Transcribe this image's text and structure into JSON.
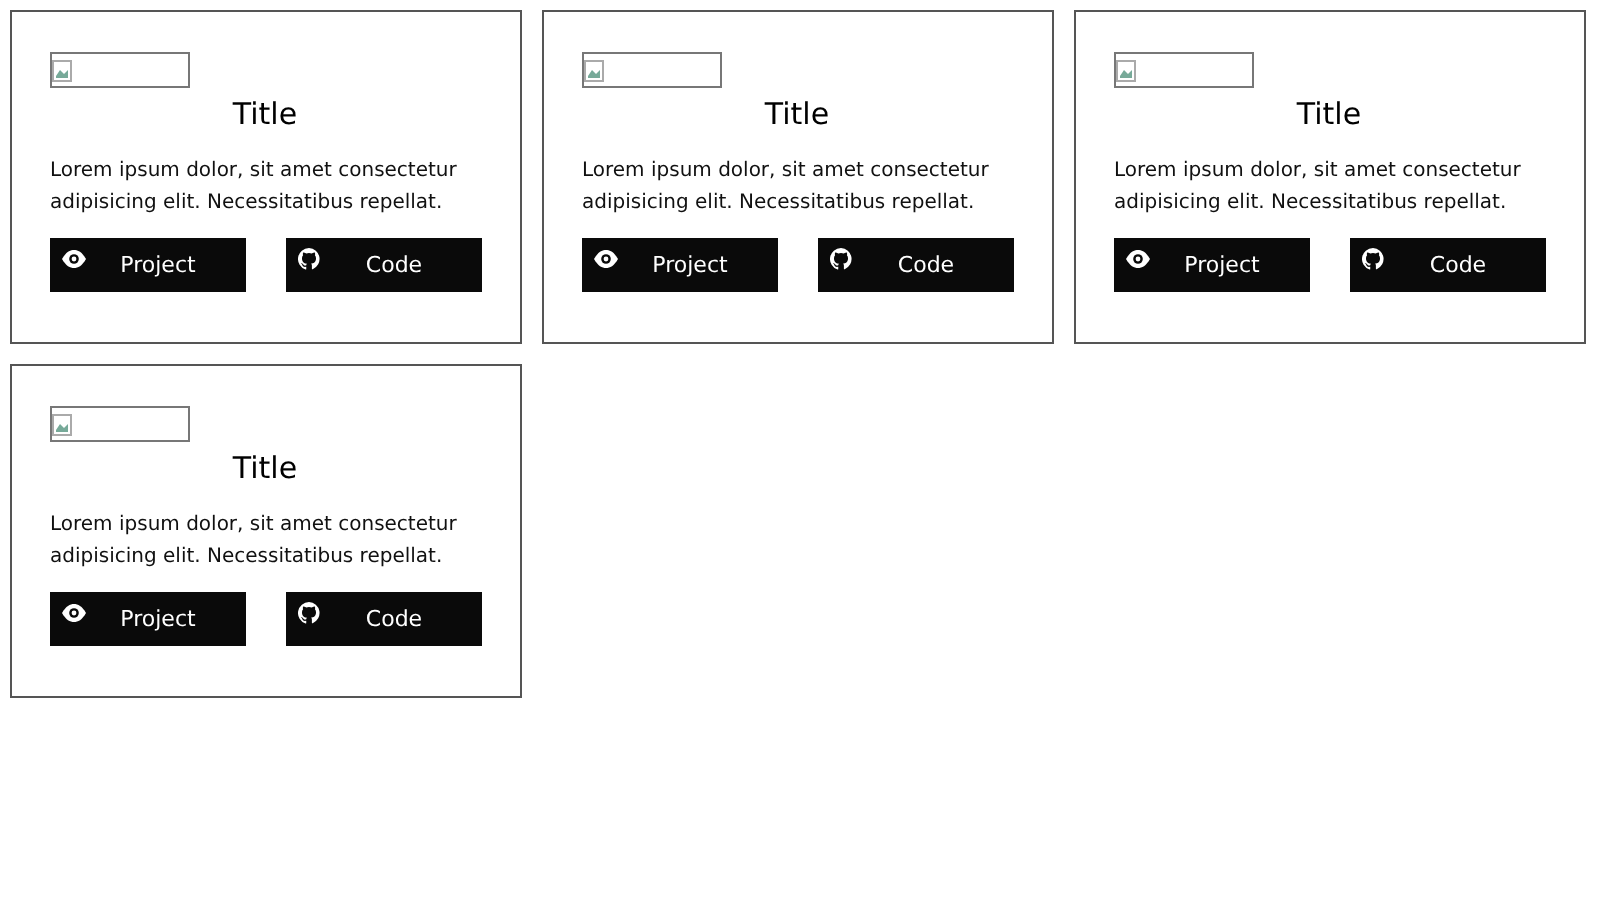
{
  "cards": [
    {
      "title": "Title",
      "description": "Lorem ipsum dolor, sit amet consectetur adipisicing elit. Necessitatibus repellat.",
      "buttons": [
        {
          "kind": "view",
          "label": "Project"
        },
        {
          "kind": "code",
          "label": "Code"
        }
      ]
    },
    {
      "title": "Title",
      "description": "Lorem ipsum dolor, sit amet consectetur adipisicing elit. Necessitatibus repellat.",
      "buttons": [
        {
          "kind": "view",
          "label": "Project"
        },
        {
          "kind": "code",
          "label": "Code"
        }
      ]
    },
    {
      "title": "Title",
      "description": "Lorem ipsum dolor, sit amet consectetur adipisicing elit. Necessitatibus repellat.",
      "buttons": [
        {
          "kind": "view",
          "label": "Project"
        },
        {
          "kind": "code",
          "label": "Code"
        }
      ]
    },
    {
      "title": "Title",
      "description": "Lorem ipsum dolor, sit amet consectetur adipisicing elit. Necessitatibus repellat.",
      "buttons": [
        {
          "kind": "view",
          "label": "Project"
        },
        {
          "kind": "code",
          "label": "Code"
        }
      ]
    }
  ]
}
